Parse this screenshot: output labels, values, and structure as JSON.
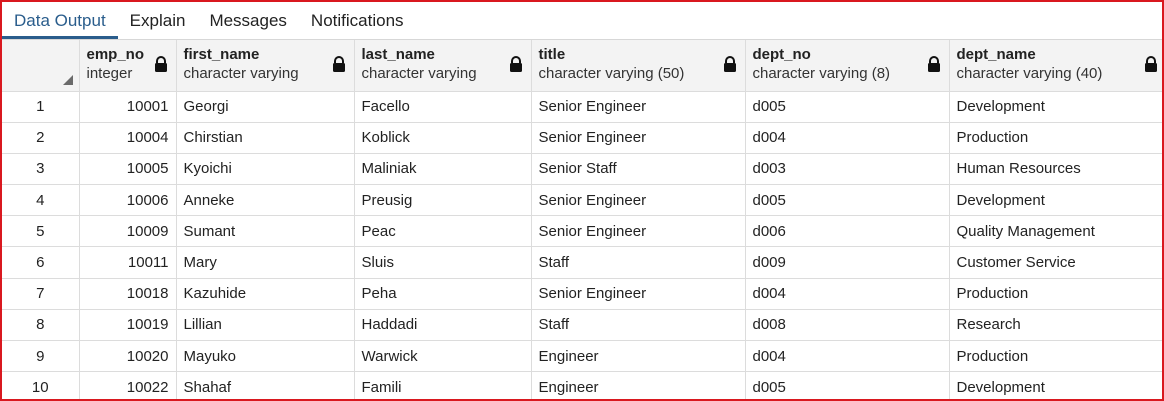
{
  "tabs": [
    {
      "label": "Data Output",
      "active": true
    },
    {
      "label": "Explain",
      "active": false
    },
    {
      "label": "Messages",
      "active": false
    },
    {
      "label": "Notifications",
      "active": false
    }
  ],
  "columns": [
    {
      "name": "emp_no",
      "type": "integer"
    },
    {
      "name": "first_name",
      "type": "character varying"
    },
    {
      "name": "last_name",
      "type": "character varying"
    },
    {
      "name": "title",
      "type": "character varying (50)"
    },
    {
      "name": "dept_no",
      "type": "character varying (8)"
    },
    {
      "name": "dept_name",
      "type": "character varying (40)"
    }
  ],
  "rows": [
    {
      "n": "1",
      "cells": [
        "10001",
        "Georgi",
        "Facello",
        "Senior Engineer",
        "d005",
        "Development"
      ]
    },
    {
      "n": "2",
      "cells": [
        "10004",
        "Chirstian",
        "Koblick",
        "Senior Engineer",
        "d004",
        "Production"
      ]
    },
    {
      "n": "3",
      "cells": [
        "10005",
        "Kyoichi",
        "Maliniak",
        "Senior Staff",
        "d003",
        "Human Resources"
      ]
    },
    {
      "n": "4",
      "cells": [
        "10006",
        "Anneke",
        "Preusig",
        "Senior Engineer",
        "d005",
        "Development"
      ]
    },
    {
      "n": "5",
      "cells": [
        "10009",
        "Sumant",
        "Peac",
        "Senior Engineer",
        "d006",
        "Quality Management"
      ]
    },
    {
      "n": "6",
      "cells": [
        "10011",
        "Mary",
        "Sluis",
        "Staff",
        "d009",
        "Customer Service"
      ]
    },
    {
      "n": "7",
      "cells": [
        "10018",
        "Kazuhide",
        "Peha",
        "Senior Engineer",
        "d004",
        "Production"
      ]
    },
    {
      "n": "8",
      "cells": [
        "10019",
        "Lillian",
        "Haddadi",
        "Staff",
        "d008",
        "Research"
      ]
    },
    {
      "n": "9",
      "cells": [
        "10020",
        "Mayuko",
        "Warwick",
        "Engineer",
        "d004",
        "Production"
      ]
    },
    {
      "n": "10",
      "cells": [
        "10022",
        "Shahaf",
        "Famili",
        "Engineer",
        "d005",
        "Development"
      ]
    }
  ],
  "colors": {
    "accent": "#2a5d8c",
    "frame": "#d9181f"
  }
}
